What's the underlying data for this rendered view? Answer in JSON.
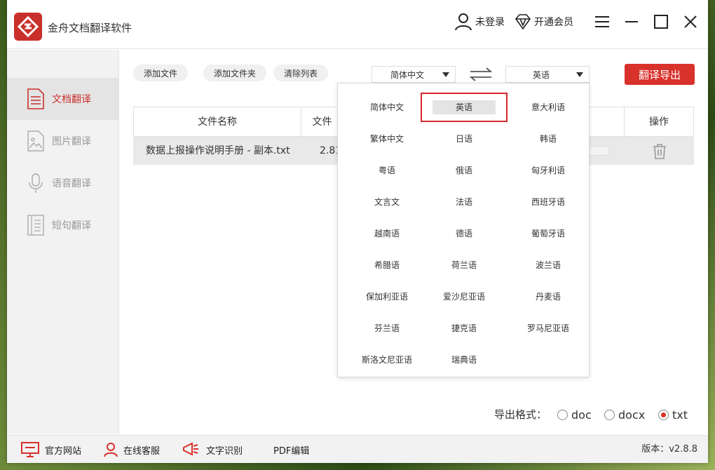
{
  "app": {
    "title": "金舟文档翻译软件"
  },
  "titlebar": {
    "login_label": "未登录",
    "vip_label": "开通会员"
  },
  "sidebar": {
    "items": [
      {
        "label": "文档翻译",
        "icon": "document-icon",
        "active": true
      },
      {
        "label": "图片翻译",
        "icon": "image-icon",
        "active": false
      },
      {
        "label": "语音翻译",
        "icon": "microphone-icon",
        "active": false
      },
      {
        "label": "短句翻译",
        "icon": "text-lines-icon",
        "active": false
      }
    ]
  },
  "toolbar": {
    "add_file": "添加文件",
    "add_folder": "添加文件夹",
    "clear_list": "清除列表",
    "source_lang": "简体中文",
    "target_lang": "英语",
    "export_label": "翻译导出"
  },
  "table": {
    "headers": {
      "name": "文件名称",
      "size": "文件",
      "action": "操作"
    },
    "rows": [
      {
        "name": "数据上报操作说明手册 - 副本.txt",
        "size": "2.81"
      }
    ]
  },
  "dropdown": {
    "selected": "英语",
    "languages": [
      [
        "简体中文",
        "英语",
        "意大利语"
      ],
      [
        "繁体中文",
        "日语",
        "韩语"
      ],
      [
        "粤语",
        "俄语",
        "匈牙利语"
      ],
      [
        "文言文",
        "法语",
        "西班牙语"
      ],
      [
        "越南语",
        "德语",
        "葡萄牙语"
      ],
      [
        "希腊语",
        "荷兰语",
        "波兰语"
      ],
      [
        "保加利亚语",
        "爱沙尼亚语",
        "丹麦语"
      ],
      [
        "芬兰语",
        "捷克语",
        "罗马尼亚语"
      ],
      [
        "斯洛文尼亚语",
        "瑞典语",
        ""
      ]
    ]
  },
  "export_format": {
    "label": "导出格式：",
    "options": [
      {
        "label": "doc",
        "checked": false
      },
      {
        "label": "docx",
        "checked": false
      },
      {
        "label": "txt",
        "checked": true
      }
    ]
  },
  "footer": {
    "website": "官方网站",
    "support": "在线客服",
    "ocr": "文字识别",
    "pdf": "PDF编辑",
    "version": "版本：v2.8.8"
  },
  "colors": {
    "accent": "#d9312b",
    "sidebar_bg": "#f2f2f2"
  }
}
